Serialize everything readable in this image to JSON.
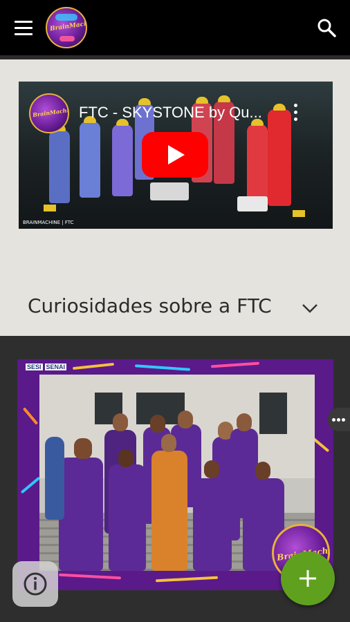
{
  "header": {
    "menu_icon": "menu-icon",
    "logo_text": "BrainMachine",
    "search_icon": "search-icon"
  },
  "video": {
    "title": "FTC - SKYSTONE by Qu...",
    "channel_logo_text": "BrainMachine",
    "footer": "BRAINMACHINE | FTC"
  },
  "accordion": {
    "label": "Curiosidades sobre a FTC",
    "icon": "chevron-down-icon"
  },
  "photo": {
    "sponsor_labels": [
      "SESI",
      "SENAI"
    ],
    "badge_text": "BrainMachine"
  },
  "colors": {
    "appbar": "#000000",
    "light_section": "#e5e3de",
    "dark_section": "#2e2e2e",
    "fab": "#5fa11f",
    "youtube_red": "#ff0000",
    "brand_purple": "#5a1a8a"
  },
  "buttons": {
    "info_icon": "info-icon",
    "fab_icon": "plus-icon",
    "more_icon": "more-horizontal-icon"
  }
}
